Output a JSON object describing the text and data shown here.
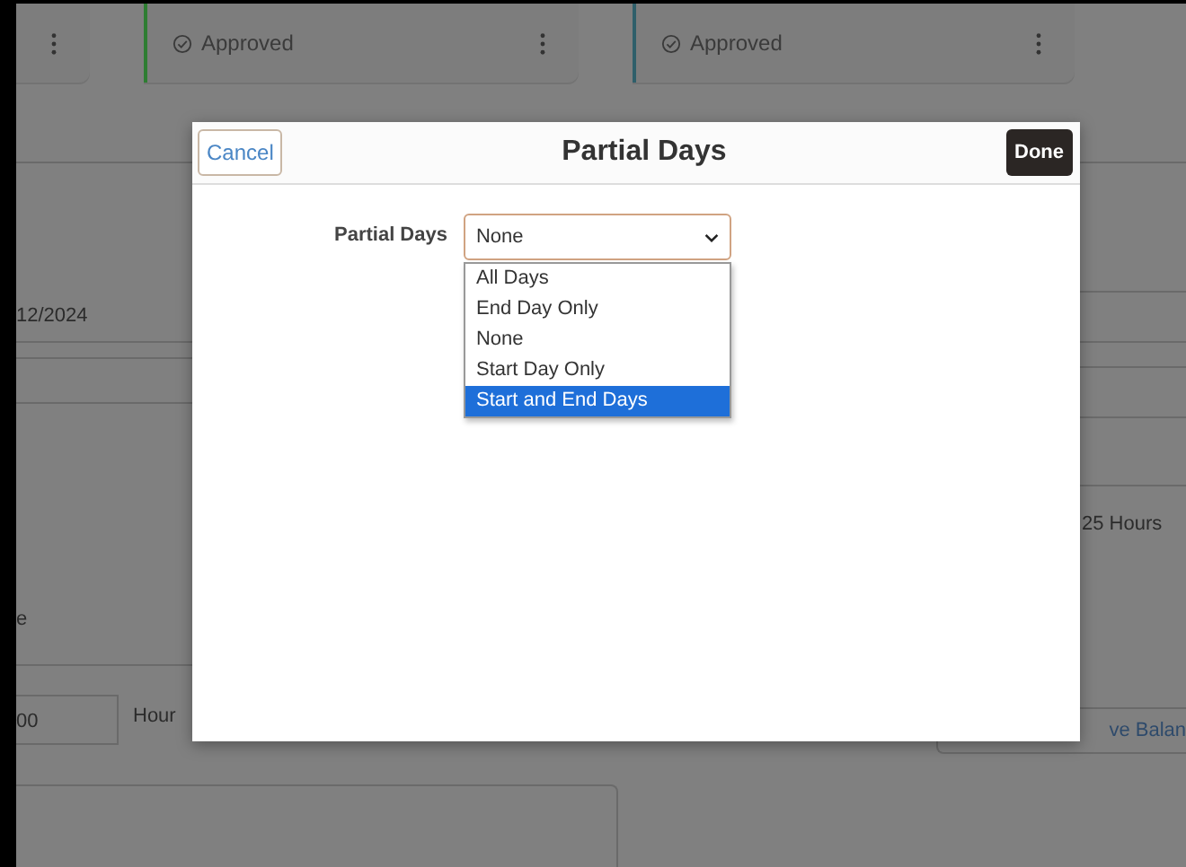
{
  "background": {
    "cards": [
      {
        "kind": "menu-only"
      },
      {
        "kind": "status",
        "status": "Approved",
        "color": "#2e7d32"
      },
      {
        "kind": "status",
        "status": "Approved",
        "color": "#2f5f6a"
      }
    ],
    "date_value": "12/2024",
    "hours_note": "25 Hours",
    "label_fragment": "e",
    "amount_value": "00",
    "amount_unit": "Hour",
    "balance_button": "ve Balan"
  },
  "dialog": {
    "title": "Partial Days",
    "cancel": "Cancel",
    "done": "Done",
    "field_label": "Partial Days",
    "select_value": "None",
    "options": [
      {
        "label": "All Days",
        "selected": false
      },
      {
        "label": "End Day Only",
        "selected": false
      },
      {
        "label": "None",
        "selected": false
      },
      {
        "label": "Start Day Only",
        "selected": false
      },
      {
        "label": "Start and End Days",
        "selected": true
      }
    ]
  }
}
